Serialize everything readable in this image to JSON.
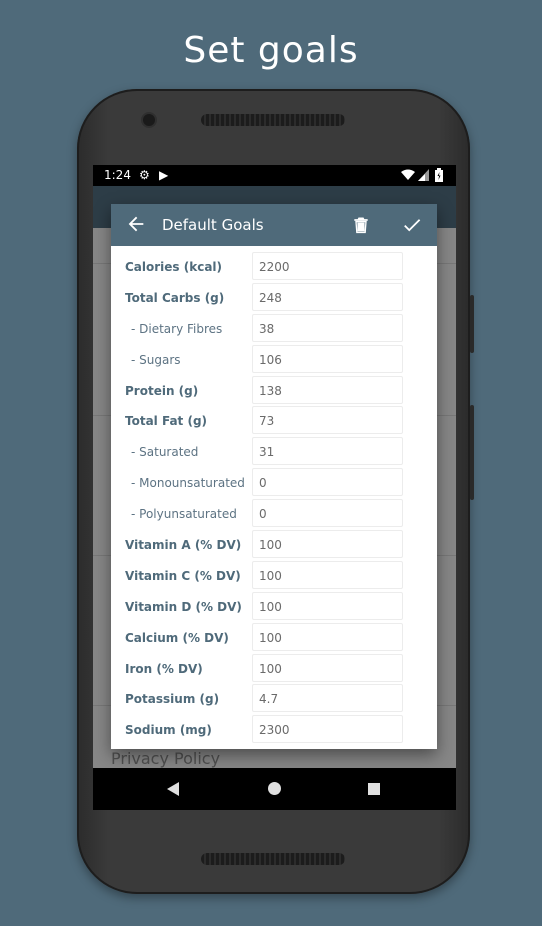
{
  "headline": "Set goals",
  "status_bar": {
    "time": "1:24"
  },
  "background_screen": {
    "privacy_label": "Privacy Policy"
  },
  "dialog": {
    "title": "Default Goals",
    "rows": [
      {
        "label": "Calories (kcal)",
        "value": "2200",
        "sub": false
      },
      {
        "label": "Total Carbs (g)",
        "value": "248",
        "sub": false
      },
      {
        "label": "- Dietary Fibres",
        "value": "38",
        "sub": true
      },
      {
        "label": "- Sugars",
        "value": "106",
        "sub": true
      },
      {
        "label": "Protein (g)",
        "value": "138",
        "sub": false
      },
      {
        "label": "Total Fat (g)",
        "value": "73",
        "sub": false
      },
      {
        "label": "- Saturated",
        "value": "31",
        "sub": true
      },
      {
        "label": "- Monounsaturated",
        "value": "0",
        "sub": true
      },
      {
        "label": "- Polyunsaturated",
        "value": "0",
        "sub": true
      },
      {
        "label": "Vitamin A (% DV)",
        "value": "100",
        "sub": false
      },
      {
        "label": "Vitamin C (% DV)",
        "value": "100",
        "sub": false
      },
      {
        "label": "Vitamin D (% DV)",
        "value": "100",
        "sub": false
      },
      {
        "label": "Calcium (% DV)",
        "value": "100",
        "sub": false
      },
      {
        "label": "Iron (% DV)",
        "value": "100",
        "sub": false
      },
      {
        "label": "Potassium (g)",
        "value": "4.7",
        "sub": false
      },
      {
        "label": "Sodium (mg)",
        "value": "2300",
        "sub": false
      }
    ]
  },
  "colors": {
    "primary": "#4f6a7a",
    "label": "#4f6a7a",
    "value": "#6a6a6a"
  },
  "icons": {
    "back": "arrow-left-icon",
    "delete": "trash-icon",
    "save": "check-icon",
    "settings": "gear-icon",
    "wifi": "wifi-icon",
    "signal": "signal-icon",
    "battery": "battery-icon"
  }
}
